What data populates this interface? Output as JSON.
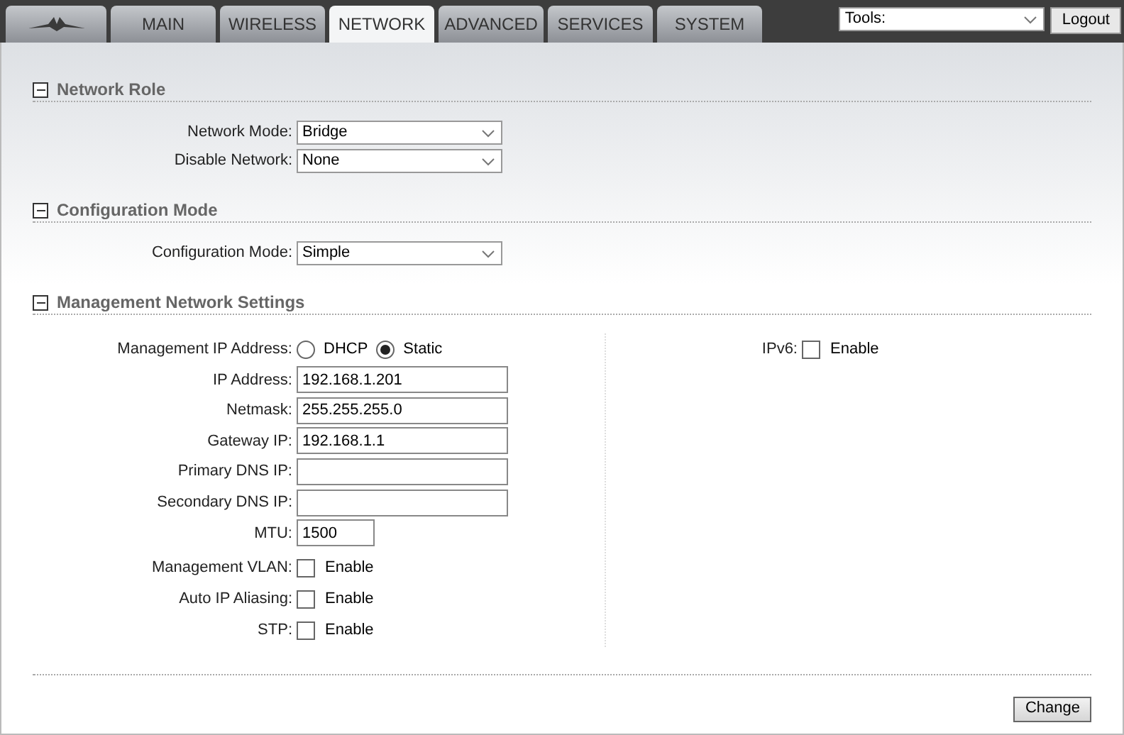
{
  "tabs": [
    {
      "kind": "logo",
      "selected": false
    },
    {
      "kind": "text",
      "label": "MAIN",
      "selected": false
    },
    {
      "kind": "text",
      "label": "WIRELESS",
      "selected": false
    },
    {
      "kind": "text",
      "label": "NETWORK",
      "selected": true
    },
    {
      "kind": "text",
      "label": "ADVANCED",
      "selected": false
    },
    {
      "kind": "text",
      "label": "SERVICES",
      "selected": false
    },
    {
      "kind": "text",
      "label": "SYSTEM",
      "selected": false
    }
  ],
  "tools": {
    "value": "Tools:"
  },
  "logout": "Logout",
  "sections": [
    {
      "title": "Network Role",
      "expanded": true,
      "fields": [
        {
          "kind": "select",
          "label": "Network Mode:",
          "value": "Bridge"
        },
        {
          "kind": "select",
          "label": "Disable Network:",
          "value": "None"
        }
      ]
    },
    {
      "title": "Configuration Mode",
      "expanded": true,
      "fields": [
        {
          "kind": "select",
          "label": "Configuration Mode:",
          "value": "Simple"
        }
      ]
    },
    {
      "title": "Management Network Settings",
      "expanded": true,
      "fields": [
        {
          "kind": "radio",
          "label": "Management IP Address:",
          "options": [
            {
              "label": "DHCP",
              "selected": false
            },
            {
              "label": "Static",
              "selected": true
            }
          ]
        },
        {
          "kind": "text",
          "label": "IP Address:",
          "value": "192.168.1.201"
        },
        {
          "kind": "text",
          "label": "Netmask:",
          "value": "255.255.255.0"
        },
        {
          "kind": "text",
          "label": "Gateway IP:",
          "value": "192.168.1.1"
        },
        {
          "kind": "text",
          "label": "Primary DNS IP:"
        },
        {
          "kind": "text",
          "label": "Secondary DNS IP:"
        },
        {
          "kind": "short",
          "label": "MTU:",
          "value": "1500"
        },
        {
          "kind": "checkbox",
          "label": "Management VLAN:",
          "option": "Enable",
          "checked": false
        },
        {
          "kind": "checkbox",
          "label": "Auto IP Aliasing:",
          "option": "Enable",
          "checked": false
        },
        {
          "kind": "checkbox",
          "label": "STP:",
          "option": "Enable",
          "checked": false
        }
      ],
      "side_fields": [
        {
          "kind": "checkbox",
          "label": "IPv6:",
          "option": "Enable",
          "checked": false
        }
      ]
    }
  ],
  "change": "Change"
}
